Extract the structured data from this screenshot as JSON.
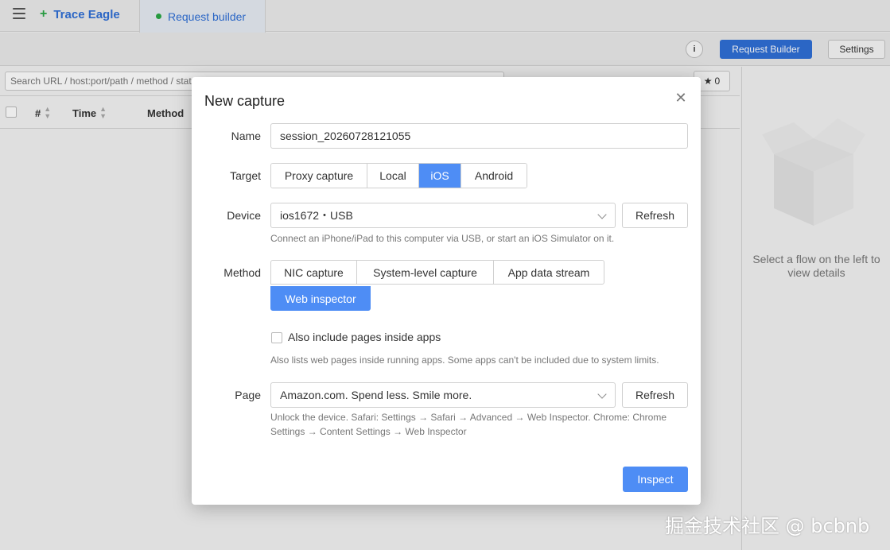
{
  "app": {
    "brand": "Trace Eagle",
    "tab_active": "Request builder",
    "info_label": "i",
    "request_builder_button": "Request Builder",
    "settings_button": "Settings",
    "search_placeholder": "Search URL / host:port/path / method / status / process / (!) / (src)",
    "star_count": "0",
    "columns": {
      "num": "#",
      "time": "Time",
      "method": "Method"
    },
    "empty_details": "Select a flow on the left to view details"
  },
  "modal": {
    "title": "New capture",
    "name_label": "Name",
    "name_value": "session_20260728121055",
    "target_label": "Target",
    "targets": [
      "Proxy capture",
      "Local",
      "iOS",
      "Android"
    ],
    "target_selected": "iOS",
    "device_label": "Device",
    "device_value": "ios1672・USB",
    "device_refresh": "Refresh",
    "device_hint": "Connect an iPhone/iPad to this computer via USB, or start an iOS Simulator on it.",
    "method_label": "Method",
    "methods": [
      "NIC capture",
      "System-level capture",
      "App data stream",
      "Web inspector"
    ],
    "method_selected": "Web inspector",
    "include_apps_label": "Also include pages inside apps",
    "include_apps_checked": false,
    "include_apps_hint": "Also lists web pages inside running apps. Some apps can't be included due to system limits.",
    "page_label": "Page",
    "page_value": "Amazon.com. Spend less. Smile more.",
    "page_refresh": "Refresh",
    "page_hint_1": "Unlock the device. Safari: Settings → Safari → Advanced → Web Inspector. Chrome: Chrome",
    "page_hint_2": "Settings → Content Settings → Web Inspector",
    "inspect_button": "Inspect"
  },
  "watermark": "掘金技术社区 @ bcbnb",
  "colors": {
    "accent": "#4e8df5",
    "brand_blue": "#2f6fd6",
    "green": "#2aa845"
  }
}
